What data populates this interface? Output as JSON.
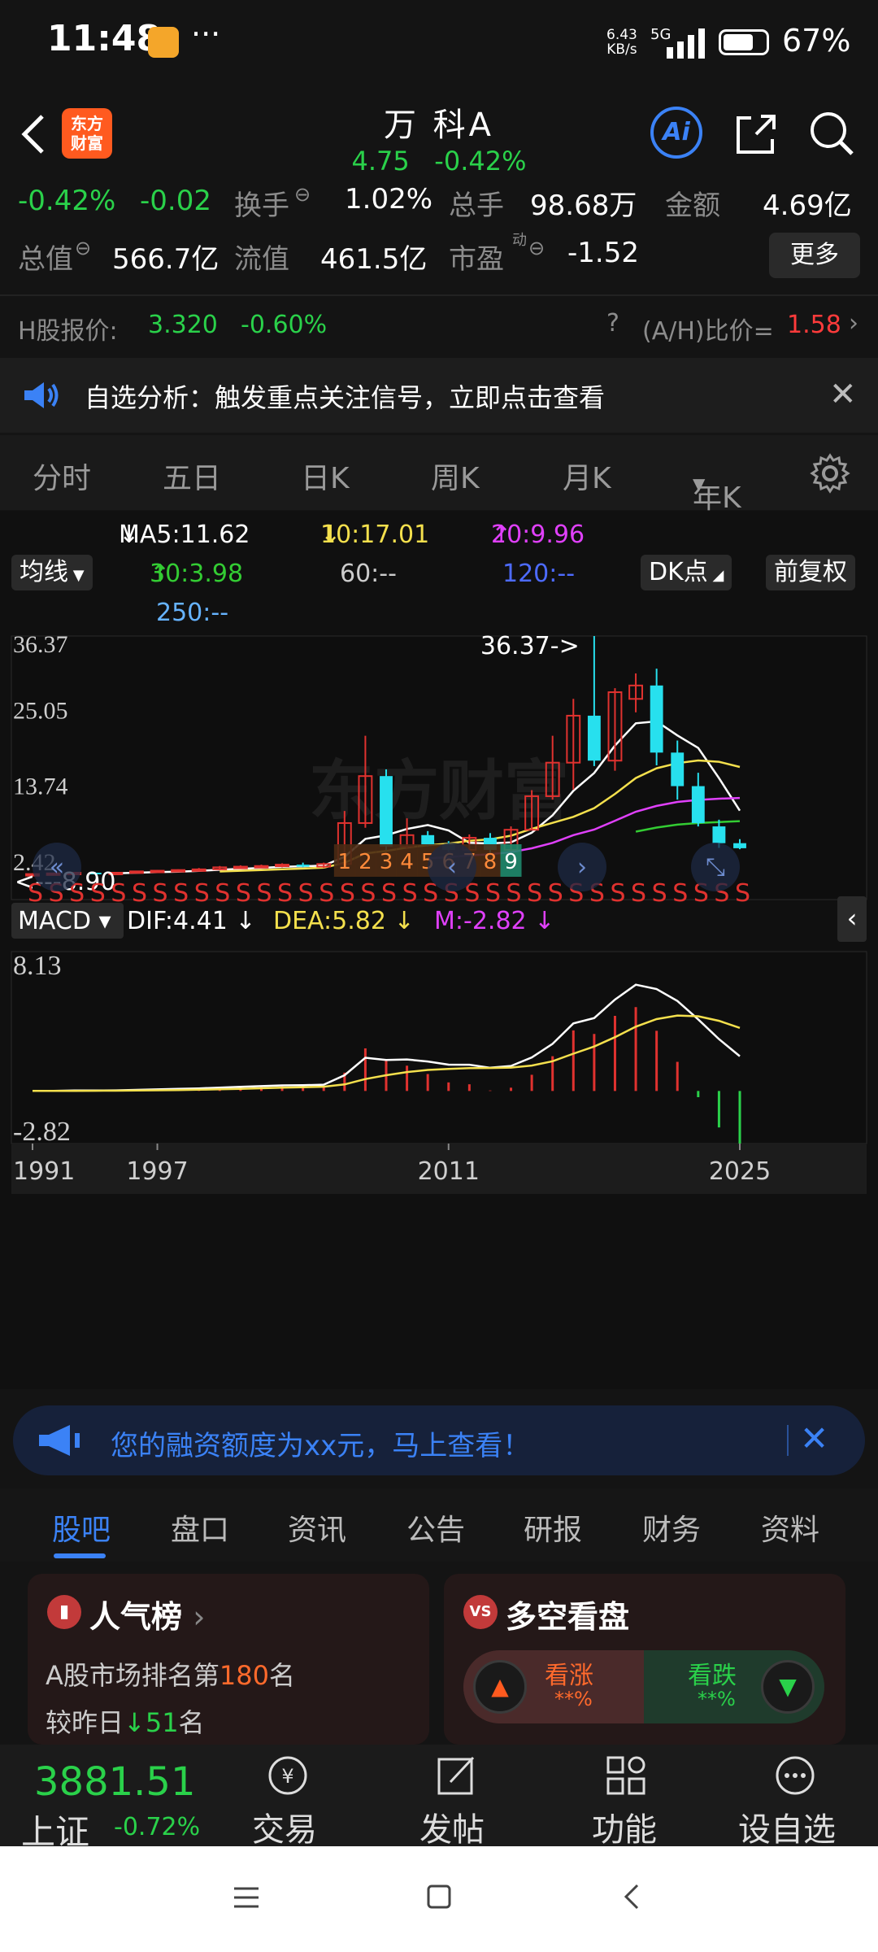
{
  "status_bar": {
    "time": "11:48",
    "more": "···",
    "speed_value": "6.43",
    "speed_unit": "KB/s",
    "network": "5G",
    "battery_pct": "67%"
  },
  "header": {
    "title": "万 科A",
    "price": "4.75",
    "change_pct": "-0.42%",
    "logo_line1": "东方",
    "logo_line2": "财富",
    "ai_label": "Ai"
  },
  "stats": {
    "pct": "-0.42%",
    "chg": "-0.02",
    "turnover_label": "换手",
    "turnover": "1.02%",
    "volume_label": "总手",
    "volume": "98.68万",
    "amount_label": "金额",
    "amount": "4.69亿",
    "mcap_label": "总值",
    "mcap": "566.7亿",
    "float_label": "流值",
    "float": "461.5亿",
    "pe_label": "市盈",
    "pe_sup": "动",
    "pe": "-1.52",
    "more": "更多"
  },
  "h_share": {
    "label": "H股报价:",
    "price": "3.320",
    "change": "-0.60%",
    "ratio_label": "(A/H)比价=",
    "ratio": "1.58"
  },
  "notice": {
    "text": "自选分析：触发重点关注信号，立即点击查看"
  },
  "period_tabs": [
    "分时",
    "五日",
    "日K",
    "周K",
    "月K",
    "年K"
  ],
  "active_period": "年K",
  "ma": {
    "selector": "均线",
    "ma5": "MA5:11.62",
    "ma10": "10:17.01",
    "ma20": "20:9.96",
    "ma30": "30:3.98",
    "ma60": "60:--",
    "ma120": "120:--",
    "ma250": "250:--",
    "dk": "DK点",
    "fq": "前复权",
    "colors": {
      "ma5": "#ffffff",
      "ma10": "#f4e04d",
      "ma20": "#e040fb",
      "ma30": "#33cc33",
      "ma60": "#cccccc",
      "ma120": "#4d6bff",
      "ma250": "#66b3ff"
    }
  },
  "chart_data": [
    {
      "type": "candlestick",
      "title": "",
      "y_ticks": [
        "36.37",
        "25.05",
        "13.74",
        "2.42"
      ],
      "ylim": [
        -2.9,
        36.37
      ],
      "x_labels": [
        "1991",
        "1997",
        "2011",
        "2025"
      ],
      "annotations": [
        "36.37->",
        "<---8.90"
      ],
      "markers": [
        "1",
        "2",
        "3",
        "4",
        "5",
        "6",
        "7",
        "8",
        "9"
      ],
      "signal_char": "S",
      "candles": [
        {
          "year": 1991,
          "o": 0.8,
          "c": 0.9,
          "h": 1.0,
          "l": 0.7
        },
        {
          "year": 1992,
          "o": 0.9,
          "c": 1.0,
          "h": 1.1,
          "l": 0.8
        },
        {
          "year": 1993,
          "o": 1.0,
          "c": 1.1,
          "h": 1.2,
          "l": 0.9
        },
        {
          "year": 1994,
          "o": 1.1,
          "c": 1.0,
          "h": 1.2,
          "l": 0.9
        },
        {
          "year": 1995,
          "o": 1.0,
          "c": 1.1,
          "h": 1.2,
          "l": 0.9
        },
        {
          "year": 1996,
          "o": 1.1,
          "c": 1.3,
          "h": 1.4,
          "l": 1.0
        },
        {
          "year": 1997,
          "o": 1.3,
          "c": 1.4,
          "h": 1.5,
          "l": 1.2
        },
        {
          "year": 1998,
          "o": 1.4,
          "c": 1.5,
          "h": 1.6,
          "l": 1.3
        },
        {
          "year": 1999,
          "o": 1.5,
          "c": 1.6,
          "h": 1.8,
          "l": 1.4
        },
        {
          "year": 2000,
          "o": 1.6,
          "c": 1.9,
          "h": 2.1,
          "l": 1.5
        },
        {
          "year": 2001,
          "o": 1.9,
          "c": 2.0,
          "h": 2.2,
          "l": 1.7
        },
        {
          "year": 2002,
          "o": 2.0,
          "c": 2.1,
          "h": 2.3,
          "l": 1.8
        },
        {
          "year": 2003,
          "o": 2.1,
          "c": 2.3,
          "h": 2.5,
          "l": 1.9
        },
        {
          "year": 2004,
          "o": 2.3,
          "c": 2.0,
          "h": 2.6,
          "l": 1.9
        },
        {
          "year": 2005,
          "o": 2.0,
          "c": 2.4,
          "h": 2.6,
          "l": 1.8
        },
        {
          "year": 2006,
          "o": 2.4,
          "c": 8.5,
          "h": 10.3,
          "l": 2.2
        },
        {
          "year": 2007,
          "o": 8.5,
          "c": 15.5,
          "h": 21.5,
          "l": 7.8
        },
        {
          "year": 2008,
          "o": 15.5,
          "c": 5.0,
          "h": 16.5,
          "l": 4.5
        },
        {
          "year": 2009,
          "o": 5.0,
          "c": 6.7,
          "h": 9.2,
          "l": 4.6
        },
        {
          "year": 2010,
          "o": 6.7,
          "c": 5.3,
          "h": 7.3,
          "l": 5.0
        },
        {
          "year": 2011,
          "o": 5.3,
          "c": 4.5,
          "h": 5.8,
          "l": 4.2
        },
        {
          "year": 2012,
          "o": 4.5,
          "c": 6.3,
          "h": 6.8,
          "l": 4.3
        },
        {
          "year": 2013,
          "o": 6.3,
          "c": 4.5,
          "h": 7.0,
          "l": 4.1
        },
        {
          "year": 2014,
          "o": 4.5,
          "c": 7.5,
          "h": 8.0,
          "l": 4.3
        },
        {
          "year": 2015,
          "o": 7.5,
          "c": 12.5,
          "h": 13.4,
          "l": 7.5
        },
        {
          "year": 2016,
          "o": 12.5,
          "c": 17.5,
          "h": 21.5,
          "l": 12.0
        },
        {
          "year": 2017,
          "o": 17.5,
          "c": 24.5,
          "h": 27.0,
          "l": 13.5
        },
        {
          "year": 2018,
          "o": 24.5,
          "c": 17.8,
          "h": 36.37,
          "l": 17.0
        },
        {
          "year": 2019,
          "o": 17.8,
          "c": 28.0,
          "h": 28.6,
          "l": 16.3
        },
        {
          "year": 2020,
          "o": 27.0,
          "c": 29.0,
          "h": 30.8,
          "l": 25.0
        },
        {
          "year": 2021,
          "o": 29.0,
          "c": 19.0,
          "h": 31.5,
          "l": 17.1
        },
        {
          "year": 2022,
          "o": 19.0,
          "c": 14.0,
          "h": 20.8,
          "l": 12.0
        },
        {
          "year": 2023,
          "o": 14.0,
          "c": 8.5,
          "h": 16.0,
          "l": 8.0
        },
        {
          "year": 2024,
          "o": 8.0,
          "c": 5.5,
          "h": 9.0,
          "l": 4.8
        },
        {
          "year": 2025,
          "o": 5.5,
          "c": 4.75,
          "h": 6.1,
          "l": 4.6
        }
      ]
    },
    {
      "type": "macd",
      "title": "MACD",
      "dif": "DIF:4.41",
      "dea": "DEA:5.82",
      "m": "M:-2.82",
      "y_ticks": [
        "8.13",
        "-2.82"
      ]
    }
  ],
  "ad": {
    "text": "您的融资额度为xx元，马上查看！"
  },
  "bottom_tabs": [
    "股吧",
    "盘口",
    "资讯",
    "公告",
    "研报",
    "财务",
    "资料"
  ],
  "active_bottom_tab": "股吧",
  "cards": {
    "popular_title": "人气榜",
    "popular_rank_pre": "A股市场排名第",
    "popular_rank": "180",
    "popular_rank_post": "名",
    "popular_change_pre": "较昨日",
    "popular_change": "51",
    "popular_change_post": "名",
    "vs_title": "多空看盘",
    "bull_label": "看涨",
    "bull_value": "**%",
    "bear_label": "看跌",
    "bear_value": "**%"
  },
  "bottom_nav": {
    "index_value": "3881.51",
    "index_name": "上证",
    "index_change": "-0.72%",
    "trade": "交易",
    "post": "发帖",
    "func": "功能",
    "add": "设自选"
  }
}
